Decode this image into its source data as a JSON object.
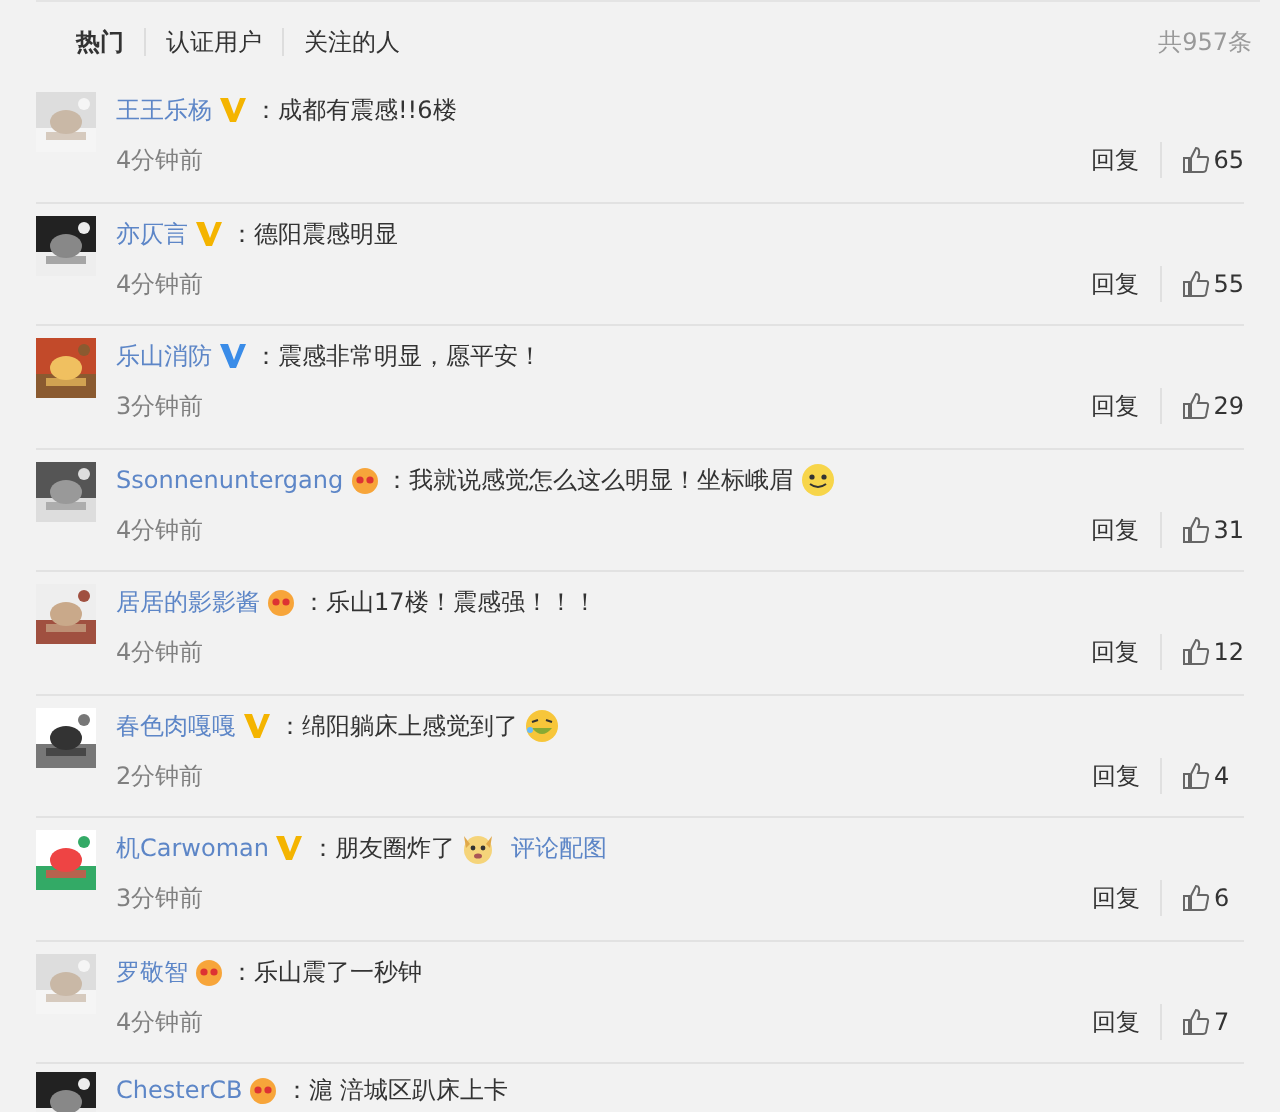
{
  "tabs": [
    {
      "label": "热门",
      "selected": true
    },
    {
      "label": "认证用户",
      "selected": false
    },
    {
      "label": "关注的人",
      "selected": false
    }
  ],
  "total": "共957条",
  "comments": [
    {
      "user": "王王乐杨",
      "badge": {
        "kind": "v",
        "color": "#f4b400"
      },
      "text": "：成都有震感!!6楼",
      "time": "4分钟前",
      "reply": "回复",
      "likes": "65"
    },
    {
      "user": "亦仄言",
      "badge": {
        "kind": "v",
        "color": "#f4b400"
      },
      "text": "：德阳震感明显",
      "time": "4分钟前",
      "reply": "回复",
      "likes": "55"
    },
    {
      "user": "乐山消防",
      "badge": {
        "kind": "v",
        "color": "#3a8ce8"
      },
      "text": "：震感非常明显，愿平安！",
      "time": "3分钟前",
      "reply": "回复",
      "likes": "29"
    },
    {
      "user": "Ssonnenuntergang",
      "badge": {
        "kind": "member"
      },
      "text": "：我就说感觉怎么这么明显！坐标峨眉",
      "emoji": {
        "kind": "smile"
      },
      "time": "4分钟前",
      "reply": "回复",
      "likes": "31"
    },
    {
      "user": "居居的影影酱",
      "badge": {
        "kind": "member"
      },
      "text": "：乐山17楼！震感强！！！",
      "time": "4分钟前",
      "reply": "回复",
      "likes": "12"
    },
    {
      "user": "春色肉嘎嘎",
      "badge": {
        "kind": "v",
        "color": "#f4b400"
      },
      "text": "：绵阳躺床上感觉到了",
      "emoji": {
        "kind": "laugh"
      },
      "time": "2分钟前",
      "reply": "回复",
      "likes": "4"
    },
    {
      "user": "机Carwoman",
      "badge": {
        "kind": "v",
        "color": "#f4b400"
      },
      "text": "：朋友圈炸了",
      "emoji": {
        "kind": "dog"
      },
      "link": "评论配图",
      "time": "3分钟前",
      "reply": "回复",
      "likes": "6"
    },
    {
      "user": "罗敬智",
      "badge": {
        "kind": "member"
      },
      "text": "：乐山震了一秒钟",
      "time": "4分钟前",
      "reply": "回复",
      "likes": "7"
    },
    {
      "user": "ChesterCB",
      "badge": {
        "kind": "member"
      },
      "text": "：滬 涪城区趴床上卡"
    }
  ]
}
